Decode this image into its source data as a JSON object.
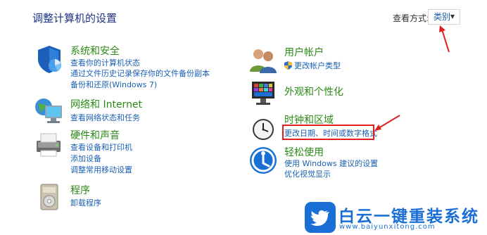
{
  "header": {
    "title": "调整计算机的设置",
    "view_by_label": "查看方式:",
    "view_by_value": "类别"
  },
  "categories": [
    {
      "title": "系统和安全",
      "links": [
        "查看你的计算机状态",
        "通过文件历史记录保存你的文件备份副本",
        "备份和还原(Windows 7)"
      ]
    },
    {
      "title": "网络和 Internet",
      "links": [
        "查看网络状态和任务"
      ]
    },
    {
      "title": "硬件和声音",
      "links": [
        "查看设备和打印机",
        "添加设备",
        "调整常用移动设置"
      ]
    },
    {
      "title": "程序",
      "links": [
        "卸载程序"
      ]
    },
    {
      "title": "用户帐户",
      "links": [
        "更改帐户类型"
      ]
    },
    {
      "title": "外观和个性化",
      "links": []
    },
    {
      "title": "时钟和区域",
      "links": [
        "更改日期、时间或数字格式"
      ]
    },
    {
      "title": "轻松使用",
      "links": [
        "使用 Windows 建议的设置",
        "优化视觉显示"
      ]
    }
  ],
  "watermark": {
    "text": "白云一键重装系统",
    "url": "www.baiyunxitong.com"
  },
  "colors": {
    "title": "#1e3287",
    "category": "#2a8a16",
    "link": "#1a5fb4",
    "annotation": "#e02020",
    "brand": "#1a6fd6"
  },
  "icons": [
    "shield-icon",
    "network-icon",
    "printer-icon",
    "programs-icon",
    "users-icon",
    "appearance-icon",
    "clock-icon",
    "ease-of-access-icon",
    "twitter-bird-icon"
  ]
}
